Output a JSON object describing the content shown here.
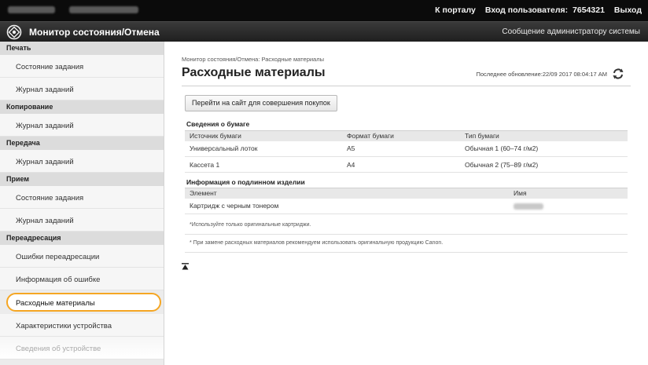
{
  "topbar": {
    "links": [
      "К порталу",
      "Вход пользователя:",
      "7654321",
      "Выход"
    ]
  },
  "titlebar": {
    "title": "Монитор состояния/Отмена",
    "admin_message": "Сообщение администратору системы"
  },
  "sidebar": {
    "sections": [
      {
        "header": "Печать",
        "items": [
          "Состояние задания",
          "Журнал заданий"
        ]
      },
      {
        "header": "Копирование",
        "items": [
          "Журнал заданий"
        ]
      },
      {
        "header": "Передача",
        "items": [
          "Журнал заданий"
        ]
      },
      {
        "header": "Прием",
        "items": [
          "Состояние задания",
          "Журнал заданий"
        ]
      },
      {
        "header": "Переадресация",
        "items": [
          "Ошибки переадресации"
        ]
      }
    ],
    "extra_items": [
      "Информация об ошибке",
      "Расходные материалы",
      "Характеристики устройства",
      "Сведения об устройстве"
    ],
    "selected": "Расходные материалы"
  },
  "main": {
    "breadcrumb": "Монитор состояния/Отмена: Расходные материалы",
    "title": "Расходные материалы",
    "last_updated": "Последнее обновление:22/09 2017 08:04:17 AM",
    "shop_button": "Перейти на сайт для совершения покупок",
    "paper": {
      "label": "Сведения о бумаге",
      "columns": [
        "Источник бумаги",
        "Формат бумаги",
        "Тип бумаги"
      ],
      "rows": [
        [
          "Универсальный лоток",
          "A5",
          "Обычная 1 (60–74 г/м2)"
        ],
        [
          "Кассета 1",
          "A4",
          "Обычная 2 (75–89 г/м2)"
        ]
      ]
    },
    "genuine": {
      "label": "Информация о подлинном изделии",
      "columns": [
        "Элемент",
        "Имя"
      ],
      "rows": [
        [
          "Картридж с черным тонером"
        ]
      ]
    },
    "note1": "*Используйте только оригинальные картриджи.",
    "note2": "* При замене расходных материалов рекомендуем использовать оригинальную продукцию Canon."
  },
  "colors": {
    "selected_outline": "#f5a623",
    "topbar": "#0b0b0b",
    "refresh_icon": "#333333"
  }
}
